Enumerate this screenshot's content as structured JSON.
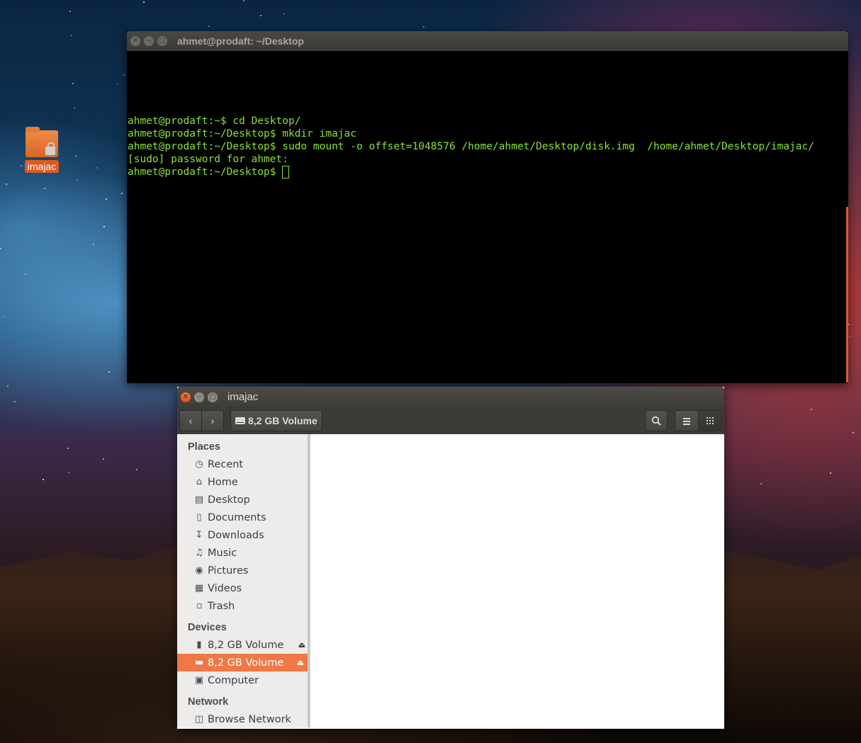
{
  "desktop": {
    "icon_label": "imajac",
    "icon_name": "locked-folder-icon"
  },
  "terminal": {
    "title": "ahmet@prodaft: ~/Desktop",
    "lines": [
      "ahmet@prodaft:~$ cd Desktop/",
      "ahmet@prodaft:~/Desktop$ mkdir imajac",
      "ahmet@prodaft:~/Desktop$ sudo mount -o offset=1048576 /home/ahmet/Desktop/disk.img  /home/ahmet/Desktop/imajac/",
      "[sudo] password for ahmet:",
      "ahmet@prodaft:~/Desktop$ "
    ],
    "text_color": "#8ae234"
  },
  "file_manager": {
    "title": "imajac",
    "path_button": "8,2 GB Volume",
    "sidebar": {
      "places_heading": "Places",
      "places": [
        {
          "label": "Recent",
          "icon": "clock-icon"
        },
        {
          "label": "Home",
          "icon": "home-icon"
        },
        {
          "label": "Desktop",
          "icon": "folder-icon"
        },
        {
          "label": "Documents",
          "icon": "document-icon"
        },
        {
          "label": "Downloads",
          "icon": "download-icon"
        },
        {
          "label": "Music",
          "icon": "music-icon"
        },
        {
          "label": "Pictures",
          "icon": "camera-icon"
        },
        {
          "label": "Videos",
          "icon": "film-icon"
        },
        {
          "label": "Trash",
          "icon": "trash-icon"
        }
      ],
      "devices_heading": "Devices",
      "devices": [
        {
          "label": "8,2 GB Volume",
          "icon": "usb-drive-icon"
        },
        {
          "label": "8,2 GB Volume",
          "icon": "harddisk-icon"
        },
        {
          "label": "Computer",
          "icon": "computer-icon"
        }
      ],
      "network_heading": "Network",
      "network": [
        {
          "label": "Browse Network",
          "icon": "network-icon"
        }
      ]
    },
    "accent_color": "#f07746"
  }
}
